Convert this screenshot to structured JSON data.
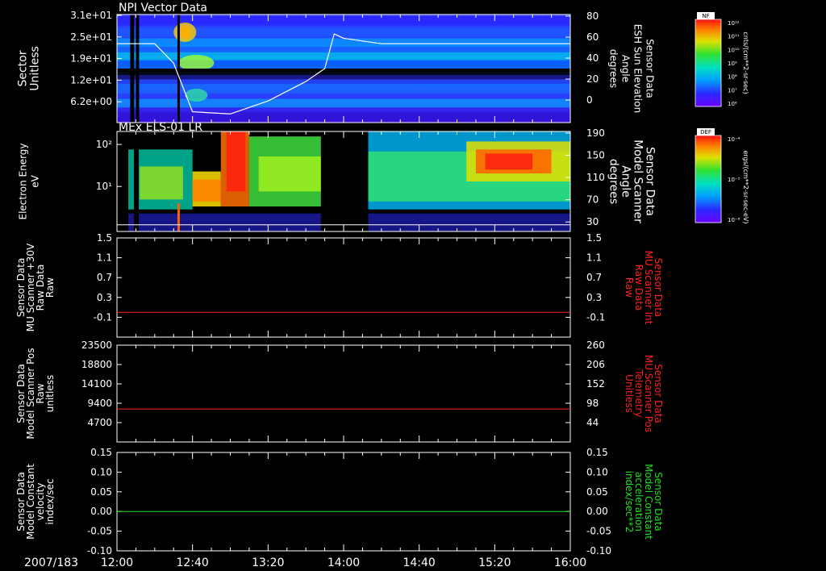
{
  "footer": {
    "date": "2007/183"
  },
  "time_ticks": [
    "12:00",
    "12:40",
    "13:20",
    "14:00",
    "14:40",
    "15:20",
    "16:00"
  ],
  "colorbars": [
    {
      "id": "nf",
      "label": "NF",
      "units": "cnts/(cm**2-sr-sec)",
      "ticks": [
        "10¹²",
        "10¹¹",
        "10¹⁰",
        "10⁹",
        "10⁸",
        "10⁷",
        "10⁶"
      ]
    },
    {
      "id": "def",
      "label": "DEF",
      "units": "ergs/(cm**2-sr-sec-eV)",
      "ticks": [
        "10⁻⁴",
        "10⁻⁵",
        "10⁻⁶"
      ]
    }
  ],
  "colors": {
    "red": "#ff2020",
    "green": "#20e020",
    "axis": "#ffffff"
  },
  "chart_data": [
    {
      "type": "heatmap",
      "title": "NPI Vector Data",
      "ylabel": [
        "Sector",
        "Unitless"
      ],
      "ylabel2": [
        "Sensor Data",
        "ESH Sun Elevation",
        "Angle",
        "degrees"
      ],
      "yticks": [
        "3.1e+01",
        "2.5e+01",
        "1.9e+01",
        "1.2e+01",
        "6.2e+00"
      ],
      "yticks2": [
        "80",
        "60",
        "40",
        "20",
        "0"
      ],
      "ylim2": [
        -20,
        80
      ],
      "overlay_line": {
        "name": "Sun Elevation Angle",
        "x": [
          "12:00",
          "12:20",
          "12:30",
          "12:40",
          "13:00",
          "13:20",
          "13:40",
          "13:50",
          "13:55",
          "14:00",
          "14:20",
          "15:00",
          "16:00"
        ],
        "y": [
          53,
          53,
          35,
          -10,
          -12,
          0,
          18,
          30,
          62,
          58,
          53,
          53,
          53
        ]
      }
    },
    {
      "type": "heatmap",
      "title": "MEx ELS-01 LR",
      "ylabel": [
        "Electron Energy",
        "eV"
      ],
      "ylabel2": [
        "Sensor Data",
        "Model Scanner",
        "Angle",
        "degrees"
      ],
      "yticks": [
        "10²",
        "10¹"
      ],
      "yticks2": [
        "190",
        "150",
        "110",
        "70",
        "30"
      ],
      "ylim2": [
        10,
        190
      ],
      "data_gap": [
        "13:48",
        "14:13"
      ]
    },
    {
      "type": "line",
      "ylabel": [
        "Sensor Data",
        "MU Scanner +30V",
        "Raw Data",
        "Raw"
      ],
      "ylabel2": [
        "Sensor Data",
        "MU Scanner Int",
        "Raw Data",
        "Raw"
      ],
      "yticks": [
        "1.5",
        "1.1",
        "0.7",
        "0.3",
        "-0.1"
      ],
      "yticks2": [
        "1.5",
        "1.1",
        "0.7",
        "0.3",
        "-0.1"
      ],
      "ylim": [
        -0.5,
        1.5
      ],
      "series": [
        {
          "color": "#ff2020",
          "x": [
            "12:00",
            "16:00"
          ],
          "y": [
            0.0,
            0.0
          ]
        }
      ]
    },
    {
      "type": "line",
      "ylabel": [
        "Sensor Data",
        "Model Scanner Pos",
        "Raw",
        "unitless"
      ],
      "ylabel2": [
        "Sensor Data",
        "MU Scanner Pos",
        "Telemetry",
        "Unitless"
      ],
      "yticks": [
        "23500",
        "18800",
        "14100",
        "9400",
        "4700"
      ],
      "yticks2": [
        "260",
        "206",
        "152",
        "98",
        "44"
      ],
      "ylim": [
        0,
        23500
      ],
      "series": [
        {
          "color": "#ff2020",
          "x": [
            "12:00",
            "16:00"
          ],
          "y": [
            8000,
            8000
          ]
        }
      ]
    },
    {
      "type": "line",
      "ylabel": [
        "Sensor Data",
        "Model Constant",
        "velocity",
        "index/sec"
      ],
      "ylabel2": [
        "Sensor Data",
        "Model Constant",
        "acceleration",
        "index/sec**2"
      ],
      "yticks": [
        "0.15",
        "0.10",
        "0.05",
        "0.00",
        "-0.05",
        "-0.10"
      ],
      "yticks2": [
        "0.15",
        "0.10",
        "0.05",
        "0.00",
        "-0.05",
        "-0.10"
      ],
      "ylim": [
        -0.1,
        0.15
      ],
      "series": [
        {
          "color": "#20e020",
          "x": [
            "12:00",
            "16:00"
          ],
          "y": [
            0.0,
            0.0
          ]
        }
      ]
    }
  ]
}
